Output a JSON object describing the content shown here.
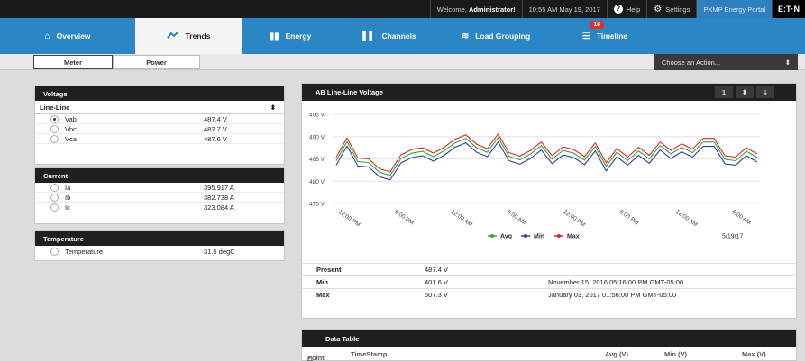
{
  "topbar": {
    "welcome_prefix": "Welcome,",
    "user": "Administrator!",
    "datetime": "10:55 AM May 19, 2017",
    "help": "Help",
    "settings": "Settings",
    "portal": "PXMP Energy Portal",
    "brand": "E:T·N"
  },
  "nav": {
    "tabs": [
      {
        "label": "Overview",
        "icon": "home-icon"
      },
      {
        "label": "Trends",
        "icon": "trend-icon"
      },
      {
        "label": "Energy",
        "icon": "bar-chart-icon"
      },
      {
        "label": "Channels",
        "icon": "channels-icon"
      },
      {
        "label": "Load Grouping",
        "icon": "stack-icon"
      },
      {
        "label": "Timeline",
        "icon": "list-icon"
      }
    ],
    "active": "Trends",
    "timeline_badge": "18"
  },
  "subnav": {
    "meter": "Meter",
    "power": "Power",
    "action": "Choose an Action..."
  },
  "voltage": {
    "title": "Voltage",
    "select": "Line-Line",
    "rows": [
      {
        "name": "Vab",
        "value": "487.4 V"
      },
      {
        "name": "Vbc",
        "value": "487.7 V"
      },
      {
        "name": "Vca",
        "value": "487.6 V"
      }
    ]
  },
  "current": {
    "title": "Current",
    "rows": [
      {
        "name": "Ia",
        "value": "395.917 A"
      },
      {
        "name": "Ib",
        "value": "382.738 A"
      },
      {
        "name": "Ic",
        "value": "323.084 A"
      }
    ]
  },
  "temperature": {
    "title": "Temperature",
    "rows": [
      {
        "name": "Temperature",
        "value": "31.5 degC"
      }
    ]
  },
  "chart": {
    "title": "AB Line-Line Voltage",
    "page": "1",
    "date": "5/19/17",
    "stats": [
      {
        "label": "Present",
        "value": "487.4 V",
        "when": ""
      },
      {
        "label": "Min",
        "value": "401.6 V",
        "when": "November 15, 2016 05:16:00 PM GMT-05:00"
      },
      {
        "label": "Max",
        "value": "507.3 V",
        "when": "January 03, 2017 01:56:00 PM GMT-05:00"
      }
    ]
  },
  "chart_data": {
    "type": "line",
    "yticks": [
      "495 V",
      "490 V",
      "485 V",
      "480 V",
      "475 V"
    ],
    "ylim": [
      475,
      495
    ],
    "xticks": [
      "12:00 PM",
      "6:00 PM",
      "12:00 AM",
      "6:00 AM",
      "12:00 PM",
      "6:00 PM",
      "12:00 AM",
      "6:00 AM"
    ],
    "series": [
      {
        "name": "Avg",
        "color": "#37a535",
        "values": [
          484.6,
          488.9,
          484.4,
          484.2,
          482.0,
          481.3,
          485.1,
          486.3,
          486.7,
          485.5,
          486.8,
          488.6,
          489.6,
          487.5,
          486.5,
          489.8,
          485.6,
          484.8,
          486.1,
          488.0,
          484.9,
          486.9,
          486.3,
          484.7,
          487.8,
          483.3,
          486.5,
          484.6,
          486.8,
          485.0,
          488.0,
          486.1,
          487.6,
          486.4,
          488.8,
          488.8,
          484.9,
          484.6,
          486.7,
          485.3
        ]
      },
      {
        "name": "Min",
        "color": "#2c3e9e",
        "values": [
          483.6,
          487.9,
          483.4,
          483.2,
          481.0,
          480.3,
          484.1,
          485.3,
          485.7,
          484.5,
          485.8,
          487.6,
          488.6,
          486.5,
          485.5,
          488.8,
          484.6,
          483.8,
          485.1,
          487.0,
          483.9,
          485.9,
          485.3,
          483.7,
          486.8,
          482.3,
          485.5,
          483.6,
          485.8,
          484.0,
          487.0,
          485.1,
          486.6,
          485.4,
          487.8,
          487.8,
          483.9,
          483.6,
          485.7,
          484.3
        ]
      },
      {
        "name": "Max",
        "color": "#d9262a",
        "values": [
          485.4,
          489.7,
          485.2,
          485.0,
          482.8,
          482.1,
          485.9,
          487.1,
          487.5,
          486.3,
          487.6,
          489.4,
          490.4,
          488.3,
          487.3,
          490.6,
          486.4,
          485.6,
          486.9,
          488.8,
          485.7,
          487.7,
          487.1,
          485.5,
          488.6,
          484.1,
          487.3,
          485.4,
          487.6,
          485.8,
          488.8,
          486.9,
          488.4,
          487.2,
          489.6,
          489.6,
          485.7,
          485.4,
          487.5,
          486.1
        ]
      }
    ],
    "legend": "bottom"
  },
  "data_table": {
    "title": "Data Table",
    "columns": [
      "Point",
      "TimeStamp",
      "Avg (V)",
      "Min (V)",
      "Max (V)"
    ]
  }
}
